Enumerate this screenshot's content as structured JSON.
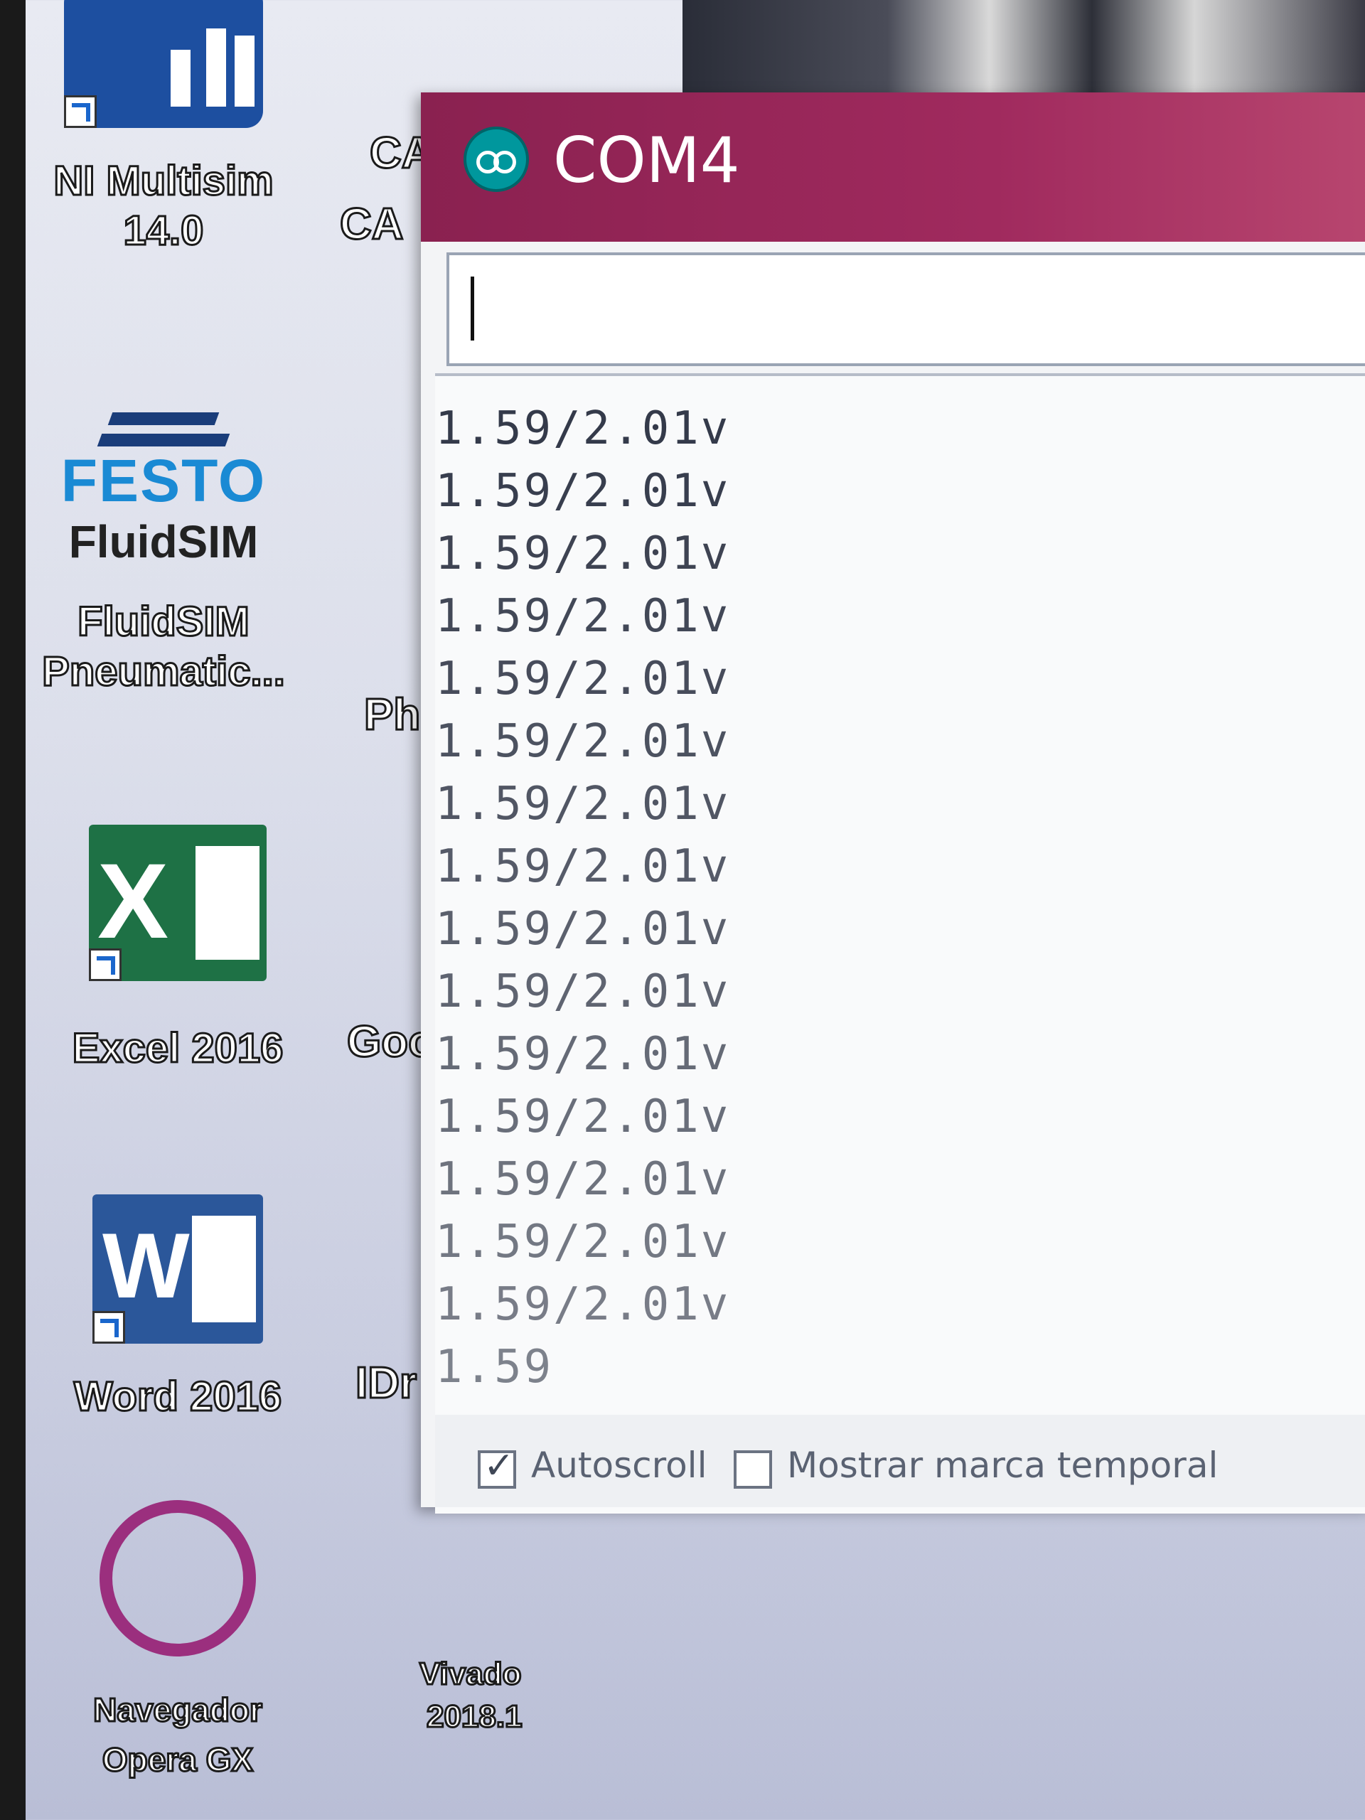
{
  "desktop": {
    "icons": [
      {
        "label_line1": "NI Multisim",
        "label_line2": "14.0"
      },
      {
        "label_line1": "FluidSIM",
        "label_line2": "Pneumatic...",
        "logo_brand": "FESTO",
        "logo_product": "FluidSIM"
      },
      {
        "label_line1": "Excel 2016",
        "logo_letter": "X"
      },
      {
        "label_line1": "Word 2016",
        "logo_letter": "W"
      },
      {
        "label_line1": "Navegador",
        "label_line2": "Opera GX"
      }
    ],
    "second_column_fragments": [
      "CA",
      "CA",
      "Ph",
      "Goo",
      "IDr",
      "Vivado",
      "2018.1"
    ]
  },
  "window": {
    "title": "COM4",
    "send_input_value": "",
    "output_lines": [
      "1.59/2.01v",
      "1.59/2.01v",
      "1.59/2.01v",
      "1.59/2.01v",
      "1.59/2.01v",
      "1.59/2.01v",
      "1.59/2.01v",
      "1.59/2.01v",
      "1.59/2.01v",
      "1.59/2.01v",
      "1.59/2.01v",
      "1.59/2.01v",
      "1.59/2.01v",
      "1.59/2.01v",
      "1.59/2.01v",
      "1.59"
    ],
    "autoscroll": {
      "label": "Autoscroll",
      "checked": true
    },
    "timestamp": {
      "label": "Mostrar marca temporal",
      "checked": false
    }
  },
  "colors": {
    "titlebar": "#a02a5e",
    "app_logo": "#00979d"
  }
}
